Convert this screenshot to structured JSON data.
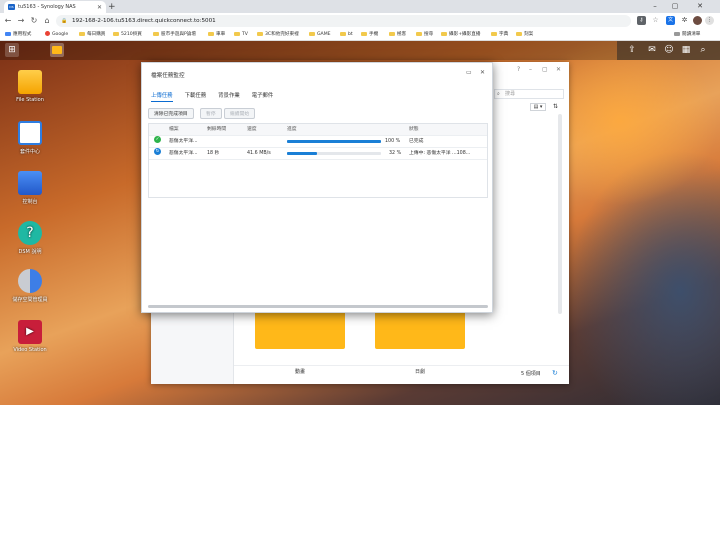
{
  "browser": {
    "tab_title": "tu5163 - Synology NAS",
    "url": "192-168-2-106.tu5163.direct.quickconnect.to:5001",
    "bookmarks": [
      "應用程式",
      "Google",
      "每日購買",
      "5210掛買",
      "股市手遊與P論壇",
      "車車",
      "TV",
      "3C和他完好東裡",
      "GAME",
      "bt",
      "手機",
      "極客",
      "搜尋",
      "攝影+攝影直播",
      "字典",
      "刻案"
    ],
    "reading_list": "閱讀清單"
  },
  "desktop": {
    "icons": [
      {
        "label": "File Station"
      },
      {
        "label": "套件中心"
      },
      {
        "label": "控制台"
      },
      {
        "label": "DSM 說明"
      },
      {
        "label": "儲存空間管理員"
      },
      {
        "label": "Video Station"
      }
    ]
  },
  "filestation": {
    "search_placeholder": "搜尋",
    "folders": [
      {
        "label": "動畫"
      },
      {
        "label": "日劇"
      }
    ],
    "status": "5 個項目"
  },
  "dialog": {
    "title": "檔案任務監控",
    "tabs": [
      "上傳任務",
      "下載任務",
      "背景作業",
      "電子郵件"
    ],
    "active_tab": 0,
    "buttons": {
      "clear": "清除已完成項目",
      "pause": "暫停",
      "resume": "繼續開始"
    },
    "columns": [
      "檔案",
      "剩餘時間",
      "速度",
      "進度",
      "狀態"
    ],
    "rows": [
      {
        "file": "悲傷太平洋...",
        "remaining": "",
        "speed": "",
        "progress": 100,
        "progress_text": "100 %",
        "status": "已完成",
        "icon": "check-icon"
      },
      {
        "file": "悲傷太平洋...",
        "remaining": "18 秒",
        "speed": "41.6 MB/s",
        "progress": 32,
        "progress_text": "32 %",
        "status": "上傳中: 悲傷太平洋 ...108...",
        "icon": "upload-sync-icon"
      }
    ]
  },
  "colors": {
    "accent": "#1a7fd6",
    "folder": "#ffb819"
  }
}
